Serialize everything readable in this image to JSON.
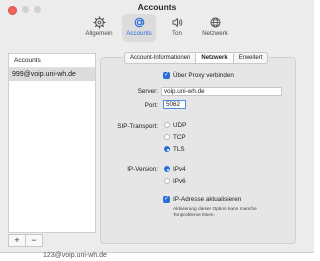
{
  "window": {
    "title": "Accounts"
  },
  "toolbar": {
    "items": [
      {
        "label": "Allgemein",
        "icon": "gear-icon"
      },
      {
        "label": "Accounts",
        "icon": "at-icon",
        "active": true
      },
      {
        "label": "Ton",
        "icon": "speaker-icon"
      },
      {
        "label": "Netzwerk",
        "icon": "globe-icon"
      }
    ]
  },
  "sidebar": {
    "header": "Accounts",
    "accounts": [
      "999@voip.uni-wh.de"
    ],
    "add_label": "+",
    "remove_label": "−"
  },
  "tabs": [
    "Account-Informationen",
    "Netzwerk",
    "Erweitert"
  ],
  "network": {
    "proxy_checkbox_label": "Über Proxy verbinden",
    "proxy_checked": true,
    "server_label": "Server:",
    "server_value": "voip.uni-wh.de",
    "port_label": "Port:",
    "port_value": "5062",
    "sip_transport_label": "SIP-Transport:",
    "sip_options": [
      "UDP",
      "TCP",
      "TLS"
    ],
    "sip_selected": "TLS",
    "ip_version_label": "IP-Version:",
    "ip_options": [
      "IPv4",
      "IPv6"
    ],
    "ip_selected": "IPv4",
    "update_ip_label": "IP-Adresse aktualisieren",
    "update_ip_checked": true,
    "update_ip_help_line1": "Aktivierung dieser Option kann manche",
    "update_ip_help_line2": "Tonprobleme lösen."
  },
  "background": {
    "partial_text": "123@voip.uni-wh.de"
  },
  "colors": {
    "accent": "#2a6fd8",
    "close": "#f0625b",
    "panel": "#e6e6e6"
  }
}
